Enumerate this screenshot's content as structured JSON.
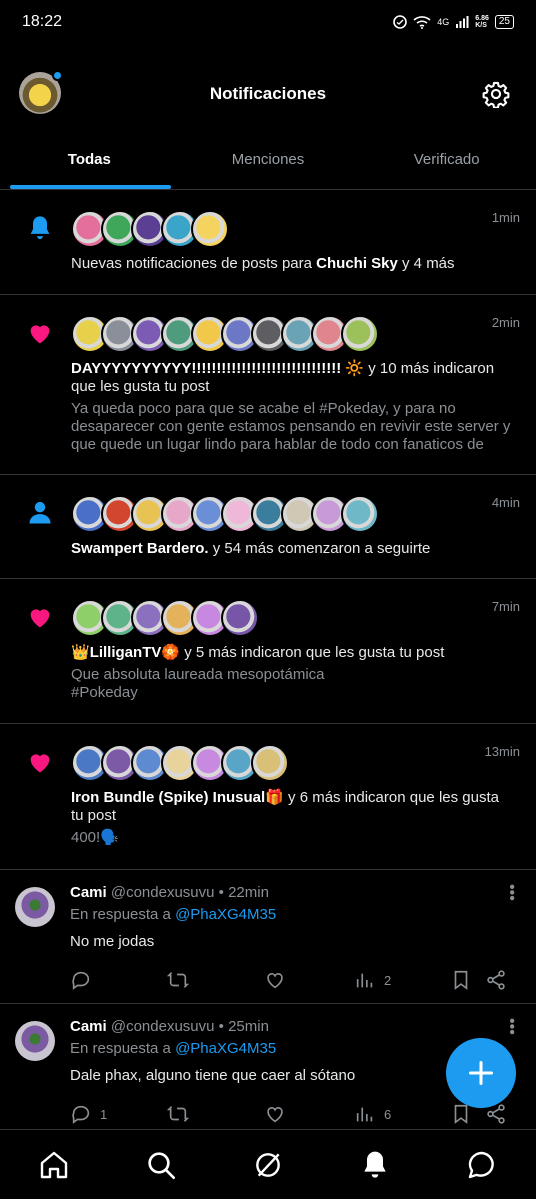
{
  "status_bar": {
    "time": "18:22",
    "network": "4G",
    "speed": "6.86\nK/S",
    "battery": "25"
  },
  "header": {
    "title": "Notificaciones"
  },
  "tabs": [
    {
      "label": "Todas",
      "active": true
    },
    {
      "label": "Menciones",
      "active": false
    },
    {
      "label": "Verificado",
      "active": false
    }
  ],
  "notifications": [
    {
      "icon": "bell-icon",
      "time": "1min",
      "avatar_colors": [
        "#e46f9c",
        "#3ea75a",
        "#5b3f92",
        "#3aa4c9",
        "#f4d35e"
      ],
      "text_pre": "Nuevas notificaciones de posts para ",
      "text_bold": "Chuchi Sky",
      "text_post": " y 4 más",
      "sub": ""
    },
    {
      "icon": "heart-icon",
      "time": "2min",
      "avatar_colors": [
        "#e7d04a",
        "#8a8f9a",
        "#7c5bb5",
        "#4e9b7e",
        "#f1c84a",
        "#6c78c6",
        "#5e5e62",
        "#6aa3b5",
        "#e0858d",
        "#9cc15a"
      ],
      "text_pre": "",
      "text_bold": "DAYYYYYYYYYY!!!!!!!!!!!!!!!!!!!!!!!!!!!!!!",
      "text_post": " 🔆 y 10 más indicaron que les gusta tu post",
      "sub": "Ya queda poco para que se acabe el #Pokeday, y para no desaparecer con gente estamos pensando en revivir este server y que quede un lugar lindo para hablar de todo con fanaticos de poki..."
    },
    {
      "icon": "person-icon",
      "time": "4min",
      "avatar_colors": [
        "#4a6fc8",
        "#d2452f",
        "#e8c252",
        "#e7a7c9",
        "#6b8fd6",
        "#f0b8d8",
        "#3b7d9d",
        "#d0c8b5",
        "#c89ad8",
        "#6fb8c8"
      ],
      "text_pre": "",
      "text_bold": "Swampert Bardero.",
      "text_post": " y 54 más comenzaron a seguirte",
      "sub": ""
    },
    {
      "icon": "heart-icon",
      "time": "7min",
      "avatar_colors": [
        "#8ecf6a",
        "#5fb38a",
        "#8b70c0",
        "#e3b25a",
        "#c887e0",
        "#7756a8"
      ],
      "text_pre": "👑",
      "text_bold": "LilliganTV🏵️",
      "text_post": " y 5 más indicaron que les gusta tu post",
      "sub": "Que absoluta laureada mesopotámica\n#Pokeday"
    },
    {
      "icon": "heart-icon",
      "time": "13min",
      "avatar_colors": [
        "#4b78c4",
        "#7d5aa5",
        "#5d8ad0",
        "#e8d49a",
        "#c88ae0",
        "#58a5c8",
        "#d9c077"
      ],
      "text_pre": "",
      "text_bold": "Iron Bundle (Spike) Inusual🎁",
      "text_post": " y 6 más indicaron que les gusta tu post",
      "sub": "400!🗣️"
    }
  ],
  "replies": [
    {
      "name": "Cami",
      "handle": "@condexusuvu",
      "time": "22min",
      "in_reply_prefix": "En respuesta a ",
      "in_reply_to": "@PhaXG4M35",
      "text": "No me jodas",
      "replies": "",
      "views": "2"
    },
    {
      "name": "Cami",
      "handle": "@condexusuvu",
      "time": "25min",
      "in_reply_prefix": "En respuesta a ",
      "in_reply_to": "@PhaXG4M35",
      "text": "Dale phax, alguno tiene que caer al sótano",
      "replies": "1",
      "views": "6"
    }
  ],
  "accent": "#1d9bf0",
  "like_color": "#f91880"
}
